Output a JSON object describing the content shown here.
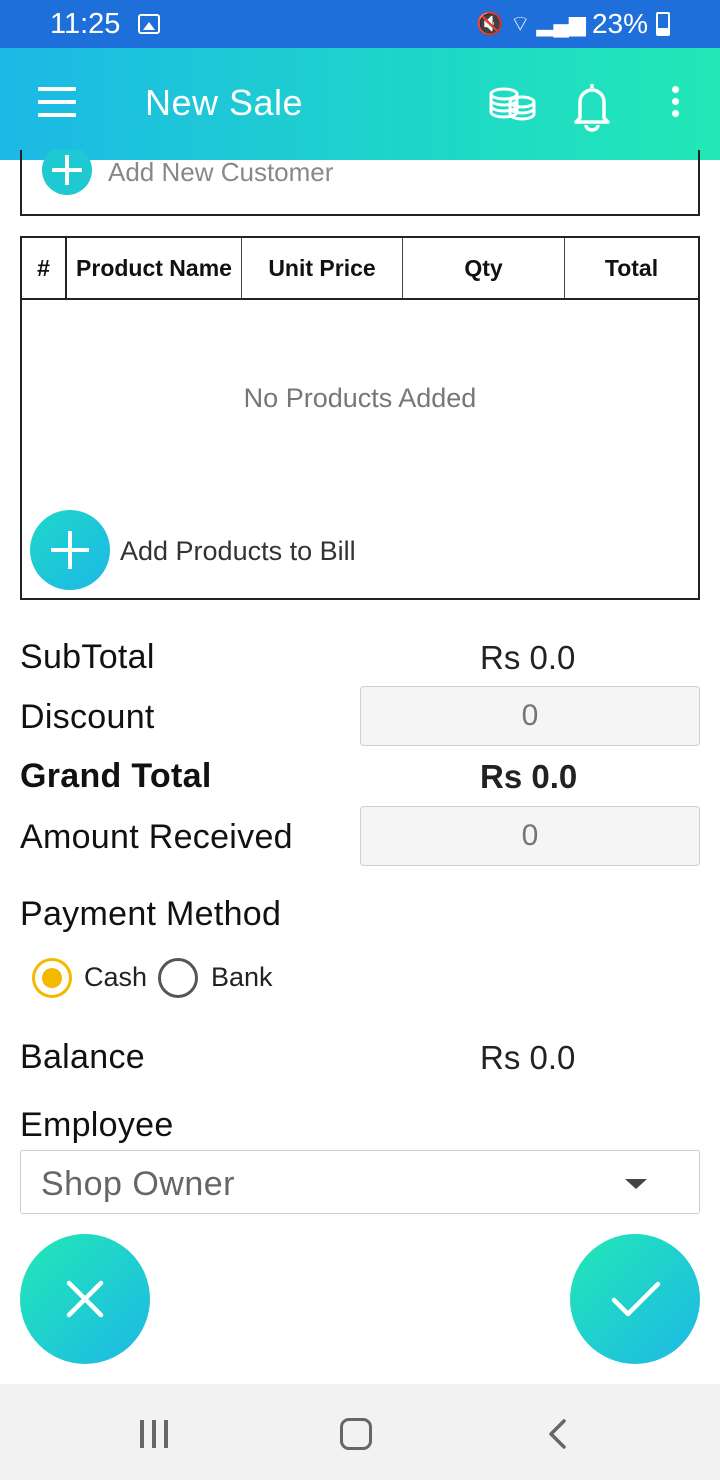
{
  "status_bar": {
    "time": "11:25",
    "battery": "23%",
    "icons": [
      "gallery-icon",
      "mute-icon",
      "data-saver-icon",
      "wifi-icon",
      "signal-icon",
      "battery-icon"
    ]
  },
  "app_bar": {
    "title": "New Sale",
    "icons": [
      "menu-icon",
      "coins-icon",
      "bell-icon",
      "more-icon"
    ],
    "gradient": [
      "#1db8e6",
      "#22e8b6"
    ]
  },
  "customer": {
    "add_label": "Add New Customer"
  },
  "products_table": {
    "columns": [
      "#",
      "Product Name",
      "Unit Price",
      "Qty",
      "Total"
    ],
    "rows": [],
    "empty_message": "No Products Added",
    "add_label": "Add Products to Bill"
  },
  "totals": {
    "subtotal_label": "SubTotal",
    "subtotal_value": "Rs 0.0",
    "discount_label": "Discount",
    "discount_placeholder": "0",
    "grand_total_label": "Grand Total",
    "grand_total_value": "Rs 0.0",
    "amount_received_label": "Amount Received",
    "amount_received_placeholder": "0"
  },
  "payment": {
    "label": "Payment Method",
    "options": [
      "Cash",
      "Bank"
    ],
    "selected": "Cash",
    "selected_color": "#f5b800"
  },
  "balance": {
    "label": "Balance",
    "value": "Rs 0.0"
  },
  "employee": {
    "label": "Employee",
    "selected": "Shop Owner"
  },
  "actions": {
    "cancel_icon": "close-icon",
    "confirm_icon": "check-icon"
  },
  "nav_bar": {
    "icons": [
      "recent-apps-icon",
      "home-icon",
      "back-icon"
    ]
  }
}
